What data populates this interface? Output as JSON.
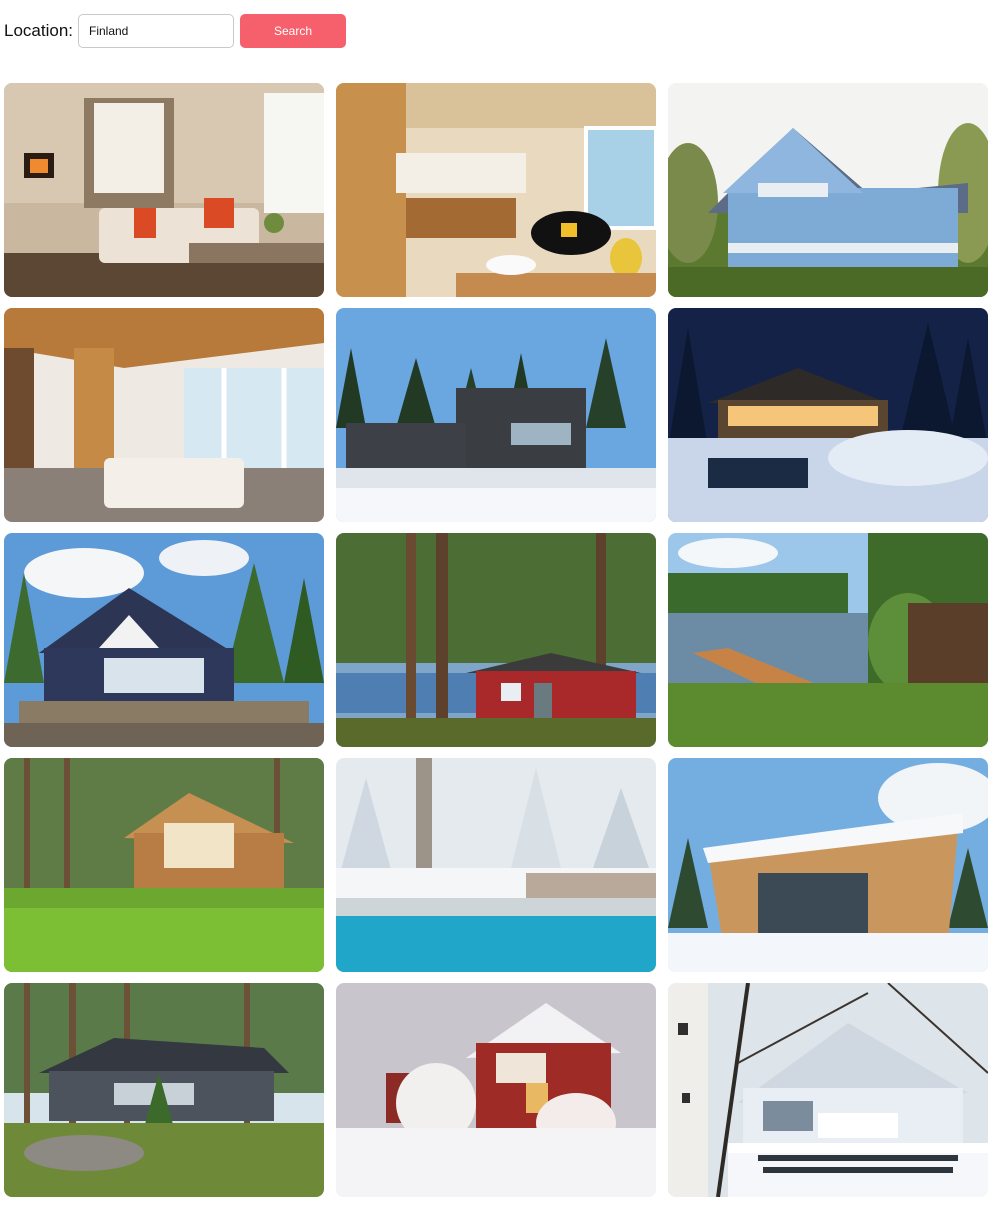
{
  "search": {
    "label": "Location:",
    "value": "Finland",
    "button": "Search"
  },
  "listings": [
    {
      "scene": "living-room-fireplace"
    },
    {
      "scene": "open-kitchen-loft"
    },
    {
      "scene": "blue-two-story-cottage"
    },
    {
      "scene": "loft-interior-windows"
    },
    {
      "scene": "modern-dark-house-winter"
    },
    {
      "scene": "lit-cabin-snow-night"
    },
    {
      "scene": "navy-cottage-deck"
    },
    {
      "scene": "red-sauna-cabin-lake"
    },
    {
      "scene": "lake-dock"
    },
    {
      "scene": "log-villa-lawn"
    },
    {
      "scene": "hot-tub-snow"
    },
    {
      "scene": "snowy-roof-modern-cabin"
    },
    {
      "scene": "grey-cottage-forest"
    },
    {
      "scene": "red-house-winter"
    },
    {
      "scene": "white-house-birch-snow"
    }
  ]
}
